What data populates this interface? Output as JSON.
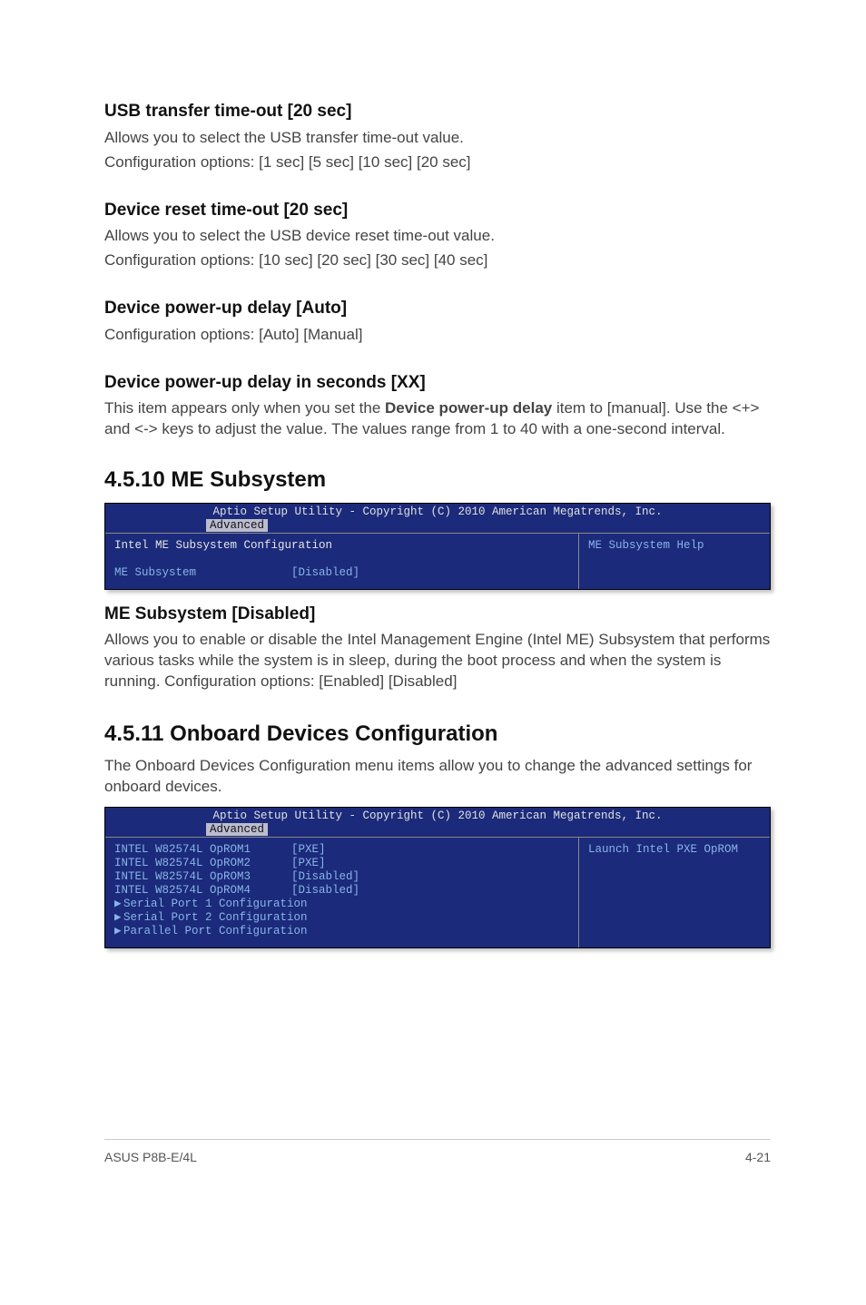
{
  "sec1": {
    "h": "USB transfer time-out [20 sec]",
    "p1": "Allows you to select the USB transfer time-out value.",
    "p2": "Configuration options: [1 sec] [5 sec] [10 sec] [20 sec]"
  },
  "sec2": {
    "h": "Device reset time-out [20 sec]",
    "p1": "Allows you to select the USB device reset time-out value.",
    "p2": "Configuration options: [10 sec] [20 sec] [30 sec] [40 sec]"
  },
  "sec3": {
    "h": "Device power-up delay [Auto]",
    "p1": "Configuration options: [Auto] [Manual]"
  },
  "sec4": {
    "h": "Device power-up delay in seconds [XX]",
    "p1a": "This item appears only when you set the ",
    "p1b": "Device power-up delay",
    "p1c": " item to [manual]. Use the <+> and <-> keys to adjust the value. The values range from 1 to 40 with a one-second interval."
  },
  "s4510": {
    "h": "4.5.10    ME Subsystem",
    "bios": {
      "header": "Aptio Setup Utility - Copyright (C) 2010 American Megatrends, Inc.",
      "tab": "Advanced",
      "left_white": "Intel ME Subsystem Configuration",
      "left_row": "ME Subsystem              [Disabled]",
      "right": "ME Subsystem Help"
    },
    "sub_h": "ME Subsystem [Disabled]",
    "sub_p": "Allows you to enable or disable the Intel Management Engine (Intel ME) Subsystem that performs various tasks while the system is in sleep, during the boot process and when the system is running. Configuration options: [Enabled] [Disabled]"
  },
  "s4511": {
    "h": "4.5.11    Onboard Devices Configuration",
    "intro": "The Onboard Devices Configuration menu items allow you to change the advanced settings for onboard devices.",
    "bios": {
      "header": "Aptio Setup Utility - Copyright (C) 2010 American Megatrends, Inc.",
      "tab": "Advanced",
      "l1": "INTEL W82574L OpROM1      [PXE]",
      "l2": "INTEL W82574L OpROM2      [PXE]",
      "l3": "INTEL W82574L OpROM3      [Disabled]",
      "l4": "INTEL W82574L OpROM4      [Disabled]",
      "link1": "Serial Port 1 Configuration",
      "link2": "Serial Port 2 Configuration",
      "link3": "Parallel Port Configuration",
      "right": "Launch Intel PXE OpROM"
    }
  },
  "footer": {
    "left": "ASUS P8B-E/4L",
    "right": "4-21"
  }
}
